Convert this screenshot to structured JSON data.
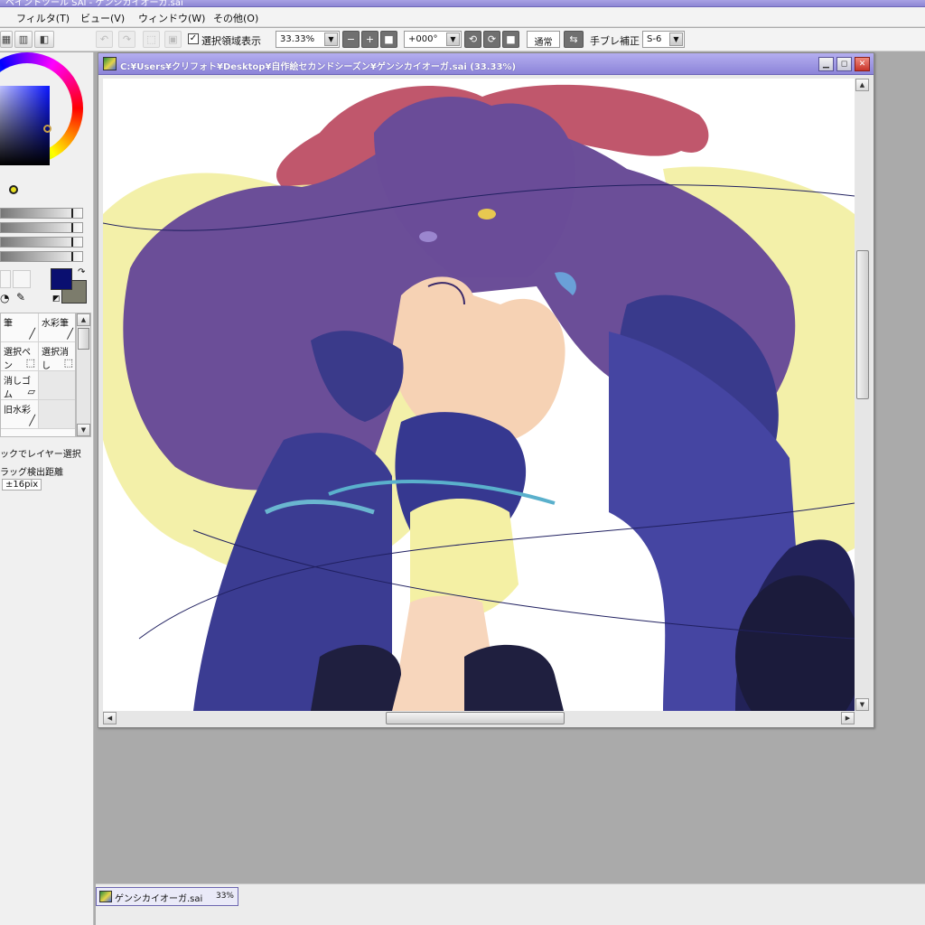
{
  "app": {
    "title": "ペイントツール SAI - ゲンシカイオーガ.sai"
  },
  "menu": {
    "items": [
      {
        "label": "フィルタ(T)"
      },
      {
        "label": "ビュー(V)"
      },
      {
        "label": "ウィンドウ(W)"
      },
      {
        "label": "その他(O)"
      }
    ]
  },
  "toolbar": {
    "selection_label": "選択領域表示",
    "selection_checked": true,
    "zoom_value": "33.33%",
    "rotation_value": "+000°",
    "blend_mode": "通常",
    "stabilizer_label": "手ブレ補正",
    "stabilizer_value": "S-6"
  },
  "color": {
    "primary": "#0a0f70",
    "secondary": "#7c7c6c"
  },
  "tools": {
    "items": [
      {
        "label": "筆"
      },
      {
        "label": "水彩筆"
      },
      {
        "label": "選択ペン"
      },
      {
        "label": "選択消し"
      },
      {
        "label": "消しゴム"
      },
      {
        "label": ""
      },
      {
        "label": "旧水彩"
      },
      {
        "label": ""
      }
    ]
  },
  "options": {
    "layer_select_text": "ックでレイヤー選択",
    "drag_distance_label": "ラッグ検出距離",
    "drag_distance_value": "±16pix"
  },
  "document": {
    "title": "C:¥Users¥クリフォト¥Desktop¥自作絵セカンドシーズン¥ゲンシカイオーガ.sai (33.33%)"
  },
  "tab": {
    "filename": "ゲンシカイオーガ.sai",
    "zoom": "33%"
  }
}
